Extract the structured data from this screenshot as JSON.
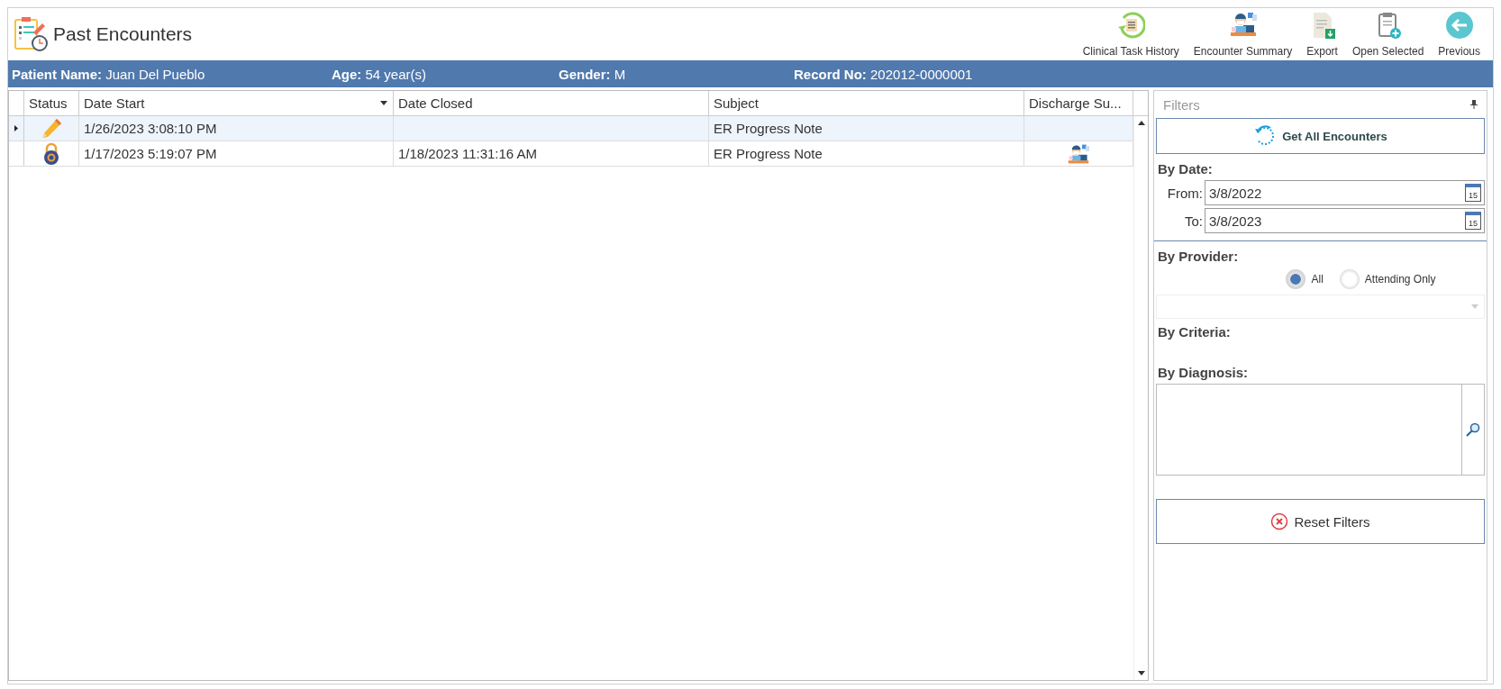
{
  "window": {
    "title": "Past Encounters"
  },
  "toolbar": [
    {
      "label": "Clinical Task History",
      "kind": "history"
    },
    {
      "label": "Encounter Summary",
      "kind": "summary"
    },
    {
      "label": "Export",
      "kind": "export"
    },
    {
      "label": "Open Selected",
      "kind": "open"
    },
    {
      "label": "Previous",
      "kind": "back"
    }
  ],
  "patient": [
    {
      "label": "Patient Name:",
      "value": "Juan Del Pueblo"
    },
    {
      "label": "Age:",
      "value": "54 year(s)"
    },
    {
      "label": "Gender:",
      "value": "M"
    },
    {
      "label": "Record No:",
      "value": "202012-0000001"
    }
  ],
  "table": {
    "columns": [
      {
        "label": "Status",
        "sorted": false
      },
      {
        "label": "Date Start",
        "sorted": true
      },
      {
        "label": "Date Closed",
        "sorted": false
      },
      {
        "label": "Subject",
        "sorted": false
      },
      {
        "label": "Discharge Su...",
        "sorted": false
      }
    ],
    "rows": [
      {
        "kind": "open",
        "date_start": "1/26/2023 3:08:10 PM",
        "date_closed": "",
        "subject": "ER Progress Note",
        "discharge_summary": false,
        "selected": true
      },
      {
        "kind": "locked",
        "date_start": "1/17/2023 5:19:07 PM",
        "date_closed": "1/18/2023 11:31:16 AM",
        "subject": "ER Progress Note",
        "discharge_summary": true,
        "selected": false
      }
    ]
  },
  "filters": {
    "title": "Filters",
    "get_all_button": "Get All Encounters",
    "by_date": "By Date:",
    "from_label": "From:",
    "from_value": "3/8/2022",
    "from_calendar_day": "15",
    "to_label": "To:",
    "to_value": "3/8/2023",
    "to_calendar_day": "15",
    "by_provider": "By Provider:",
    "provider_options": [
      {
        "label": "All",
        "selected": true
      },
      {
        "label": "Attending Only",
        "selected": false
      }
    ],
    "by_criteria": "By Criteria:",
    "by_diagnosis": "By Diagnosis:",
    "reset_button": "Reset Filters"
  }
}
